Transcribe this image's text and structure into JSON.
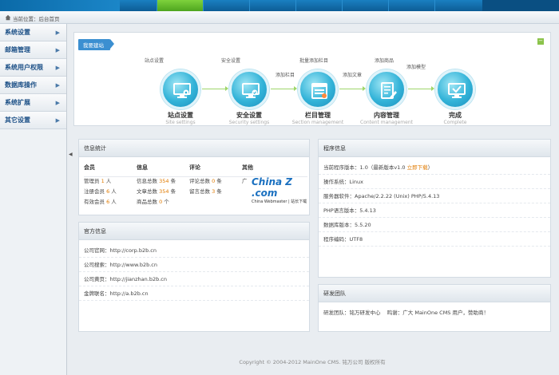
{
  "header": {
    "tabs": [
      "",
      "",
      "",
      "",
      "",
      "",
      ""
    ],
    "user_box": {
      "badge": "",
      "text": ""
    }
  },
  "breadcrumb": {
    "text": "当前位置：后台首页"
  },
  "sidebar": {
    "items": [
      {
        "label": "系统设置"
      },
      {
        "label": "邮箱管理"
      },
      {
        "label": "系统用户权限"
      },
      {
        "label": "数据库操作"
      },
      {
        "label": "系统扩展"
      },
      {
        "label": "其它设置"
      }
    ]
  },
  "quick": {
    "title": "我要建站",
    "hints": [
      "站点设置",
      "安全设置",
      "添加栏目",
      "批量添加栏目",
      "添加文章",
      "添加商品",
      "添加模型"
    ],
    "steps": [
      {
        "label": "站点设置",
        "sub": "Site settings",
        "icon": "monitor-gear-icon"
      },
      {
        "label": "安全设置",
        "sub": "Security settings",
        "icon": "monitor-shield-icon"
      },
      {
        "label": "栏目管理",
        "sub": "Section management",
        "icon": "window-list-icon"
      },
      {
        "label": "内容管理",
        "sub": "Content management",
        "icon": "document-edit-icon"
      },
      {
        "label": "完成",
        "sub": "Complete",
        "icon": "monitor-check-icon"
      }
    ]
  },
  "stats": {
    "title": "信息统计",
    "columns": [
      {
        "head": "会员",
        "rows": [
          {
            "label": "管理员",
            "num": "1",
            "unit": "人"
          },
          {
            "label": "注册会员",
            "num": "6",
            "unit": "人"
          },
          {
            "label": "有效会员",
            "num": "6",
            "unit": "人"
          }
        ]
      },
      {
        "head": "信息",
        "rows": [
          {
            "label": "信息总数",
            "num": "354",
            "unit": "条"
          },
          {
            "label": "文章总数",
            "num": "354",
            "unit": "条"
          },
          {
            "label": "商品总数",
            "num": "0",
            "unit": "个"
          }
        ]
      },
      {
        "head": "评论",
        "rows": [
          {
            "label": "评论总数",
            "num": "0",
            "unit": "条"
          },
          {
            "label": "留言总数",
            "num": "3",
            "unit": "条"
          }
        ]
      },
      {
        "head": "其他",
        "rows": [
          {
            "label": "广",
            "num": "",
            "unit": ""
          }
        ]
      }
    ],
    "watermark": {
      "line1": "China Z .com",
      "line2": "China Webmaster | 站长下载"
    }
  },
  "official": {
    "title": "官方信息",
    "rows": [
      {
        "label": "公司官网：",
        "value": "http://corp.b2b.cn"
      },
      {
        "label": "公司搜索：",
        "value": "http://www.b2b.cn"
      },
      {
        "label": "公司黄页：",
        "value": "http://jianzhan.b2b.cn"
      },
      {
        "label": "金牌联名：",
        "value": "http://a.b2b.cn"
      }
    ]
  },
  "program": {
    "title": "程序信息",
    "rows": [
      {
        "label": "当前程序版本：",
        "value": "1.0（最新版本v1.0",
        "link": "立即下载",
        "tail": "）"
      },
      {
        "label": "操作系统：",
        "value": "Linux",
        "link": "",
        "tail": ""
      },
      {
        "label": "服务器软件：",
        "value": "Apache/2.2.22 (Unix) PHP/5.4.13",
        "link": "",
        "tail": ""
      },
      {
        "label": "PHP语言版本：",
        "value": "5.4.13",
        "link": "",
        "tail": ""
      },
      {
        "label": "数据库版本：",
        "value": "5.5.20",
        "link": "",
        "tail": ""
      },
      {
        "label": "程序编码：",
        "value": "UTF8",
        "link": "",
        "tail": ""
      }
    ]
  },
  "team": {
    "title": "研发团队",
    "text": "研发团队：铭万研发中心",
    "thanks": "鸣谢：广大 MainOne CMS 用户，赞助商！"
  },
  "footer": {
    "text": "Copyright © 2004-2012 MainOne CMS. 铭万公司 版权所有"
  },
  "colors": {
    "accent": "#1a7fc1",
    "active_tab": "#5fb52a",
    "highlight": "#e07a00"
  }
}
